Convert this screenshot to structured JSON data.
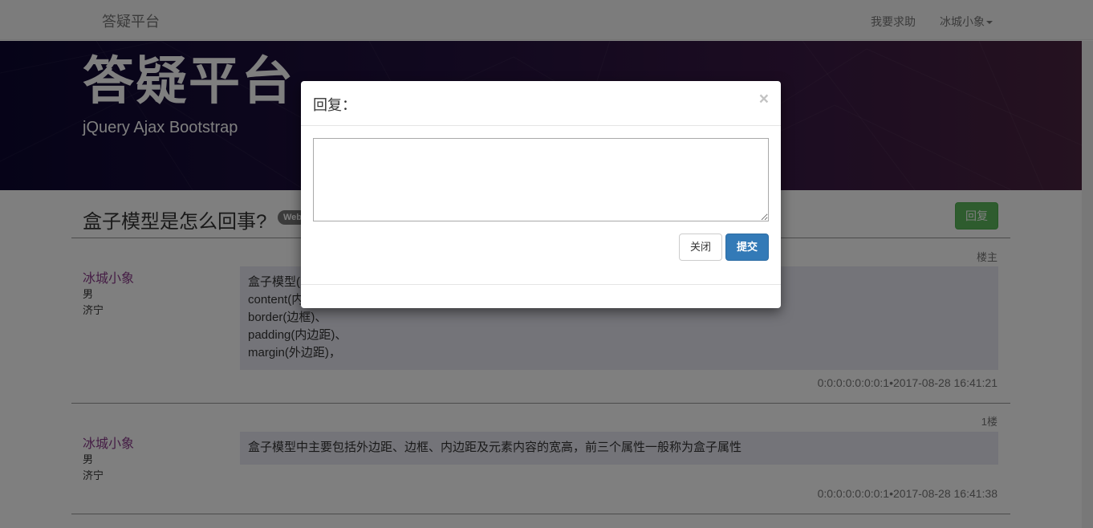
{
  "navbar": {
    "brand": "答疑平台",
    "help_link": "我要求助",
    "user_menu": "冰城小象"
  },
  "jumbotron": {
    "title": "答疑平台",
    "subtitle": "jQuery Ajax Bootstrap"
  },
  "question": {
    "title": "盒子模型是怎么回事?",
    "tag": "Web",
    "reply_button": "回复"
  },
  "posts": [
    {
      "floor": "楼主",
      "author": "冰城小象",
      "gender": "男",
      "city": "济宁",
      "content_lines": [
        "盒子模型(",
        "content(内",
        "border(边框)、",
        "padding(内边距)、",
        "margin(外边距)，"
      ],
      "footer": "0:0:0:0:0:0:0:1•2017-08-28 16:41:21"
    },
    {
      "floor": "1楼",
      "author": "冰城小象",
      "gender": "男",
      "city": "济宁",
      "content_lines": [
        "盒子模型中主要包括外边距、边框、内边距及元素内容的宽高，前三个属性一般称为盒子属性"
      ],
      "footer": "0:0:0:0:0:0:0:1•2017-08-28 16:41:38"
    }
  ],
  "modal": {
    "title": "回复：",
    "close_icon": "×",
    "textarea_value": "",
    "close_button": "关闭",
    "submit_button": "提交"
  },
  "colors": {
    "primary": "#337ab7",
    "success": "#5cb85c",
    "author": "#8a3a8a",
    "jumbotron_bg": "#1a0f3a"
  }
}
